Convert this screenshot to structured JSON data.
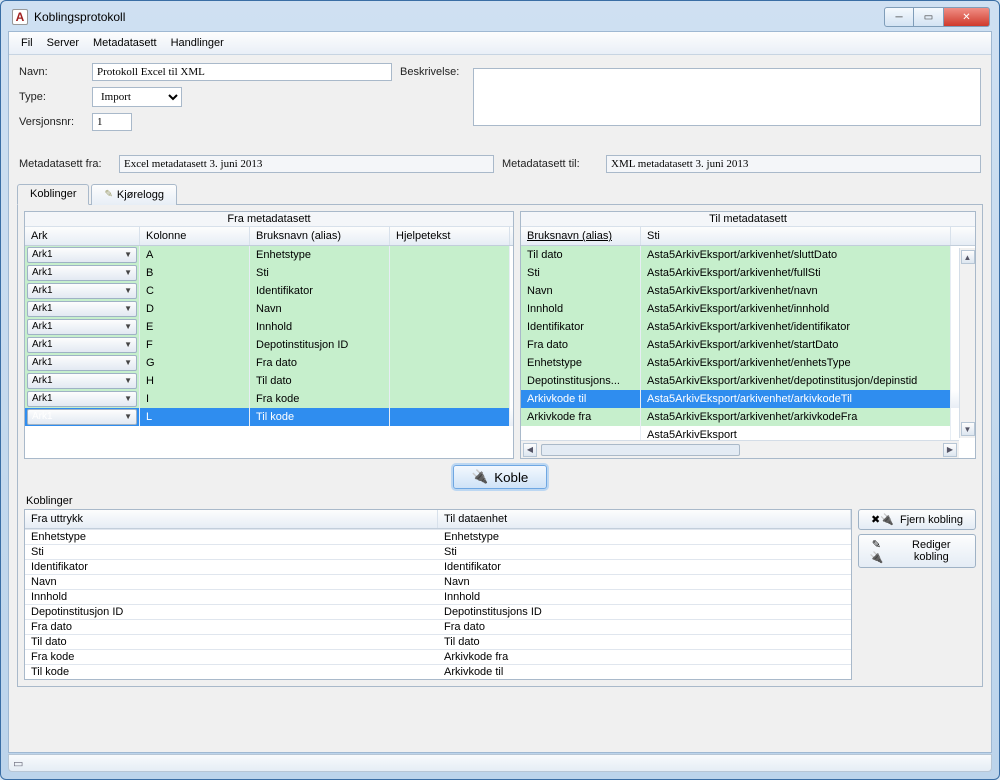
{
  "window": {
    "title": "Koblingsprotokoll"
  },
  "menubar": [
    "Fil",
    "Server",
    "Metadatasett",
    "Handlinger"
  ],
  "form": {
    "name_label": "Navn:",
    "name_value": "Protokoll Excel til XML",
    "desc_label": "Beskrivelse:",
    "desc_value": "",
    "type_label": "Type:",
    "type_value": "Import",
    "ver_label": "Versjonsnr:",
    "ver_value": "1",
    "meta_from_label": "Metadatasett fra:",
    "meta_from_value": "Excel metadatasett 3. juni 2013",
    "meta_to_label": "Metadatasett til:",
    "meta_to_value": "XML metadatasett 3. juni 2013"
  },
  "tabs": {
    "t1": "Koblinger",
    "t2": "Kjørelogg"
  },
  "leftgrid": {
    "title": "Fra metadatasett",
    "cols": {
      "ark": "Ark",
      "kol": "Kolonne",
      "alias": "Bruksnavn (alias)",
      "hjelp": "Hjelpetekst"
    },
    "rows": [
      {
        "ark": "Ark1",
        "kol": "A",
        "alias": "Enhetstype",
        "sel": false
      },
      {
        "ark": "Ark1",
        "kol": "B",
        "alias": "Sti",
        "sel": false
      },
      {
        "ark": "Ark1",
        "kol": "C",
        "alias": "Identifikator",
        "sel": false
      },
      {
        "ark": "Ark1",
        "kol": "D",
        "alias": "Navn",
        "sel": false
      },
      {
        "ark": "Ark1",
        "kol": "E",
        "alias": "Innhold",
        "sel": false
      },
      {
        "ark": "Ark1",
        "kol": "F",
        "alias": "Depotinstitusjon ID",
        "sel": false
      },
      {
        "ark": "Ark1",
        "kol": "G",
        "alias": "Fra dato",
        "sel": false
      },
      {
        "ark": "Ark1",
        "kol": "H",
        "alias": "Til dato",
        "sel": false
      },
      {
        "ark": "Ark1",
        "kol": "I",
        "alias": "Fra kode",
        "sel": false
      },
      {
        "ark": "Ark1",
        "kol": "L",
        "alias": "Til kode",
        "sel": true
      }
    ]
  },
  "rightgrid": {
    "title": "Til metadatasett",
    "cols": {
      "alias": "Bruksnavn (alias)",
      "sti": "Sti"
    },
    "rows": [
      {
        "alias": "Til dato",
        "sti": "Asta5ArkivEksport/arkivenhet/sluttDato",
        "sel": false,
        "g": true
      },
      {
        "alias": "Sti",
        "sti": "Asta5ArkivEksport/arkivenhet/fullSti",
        "sel": false,
        "g": true
      },
      {
        "alias": "Navn",
        "sti": "Asta5ArkivEksport/arkivenhet/navn",
        "sel": false,
        "g": true
      },
      {
        "alias": "Innhold",
        "sti": "Asta5ArkivEksport/arkivenhet/innhold",
        "sel": false,
        "g": true
      },
      {
        "alias": "Identifikator",
        "sti": "Asta5ArkivEksport/arkivenhet/identifikator",
        "sel": false,
        "g": true
      },
      {
        "alias": "Fra dato",
        "sti": "Asta5ArkivEksport/arkivenhet/startDato",
        "sel": false,
        "g": true
      },
      {
        "alias": "Enhetstype",
        "sti": "Asta5ArkivEksport/arkivenhet/enhetsType",
        "sel": false,
        "g": true
      },
      {
        "alias": "Depotinstitusjons...",
        "sti": "Asta5ArkivEksport/arkivenhet/depotinstitusjon/depinstid",
        "sel": false,
        "g": true
      },
      {
        "alias": "Arkivkode til",
        "sti": "Asta5ArkivEksport/arkivenhet/arkivkodeTil",
        "sel": true,
        "g": false
      },
      {
        "alias": "Arkivkode fra",
        "sti": "Asta5ArkivEksport/arkivenhet/arkivkodeFra",
        "sel": false,
        "g": true
      },
      {
        "alias": "",
        "sti": "Asta5ArkivEksport",
        "sel": false,
        "g": false
      }
    ]
  },
  "koble_button": "Koble",
  "koblinger_label": "Koblinger",
  "koblinger_cols": {
    "from": "Fra uttrykk",
    "to": "Til dataenhet"
  },
  "koblinger_rows": [
    {
      "from": "Enhetstype",
      "to": "Enhetstype"
    },
    {
      "from": "Sti",
      "to": "Sti"
    },
    {
      "from": "Identifikator",
      "to": "Identifikator"
    },
    {
      "from": "Navn",
      "to": "Navn"
    },
    {
      "from": "Innhold",
      "to": "Innhold"
    },
    {
      "from": "Depotinstitusjon ID",
      "to": "Depotinstitusjons ID"
    },
    {
      "from": "Fra dato",
      "to": "Fra dato"
    },
    {
      "from": "Til dato",
      "to": "Til dato"
    },
    {
      "from": "Fra kode",
      "to": "Arkivkode fra"
    },
    {
      "from": "Til kode",
      "to": "Arkivkode til"
    }
  ],
  "side_buttons": {
    "remove": "Fjern kobling",
    "edit": "Rediger kobling"
  }
}
